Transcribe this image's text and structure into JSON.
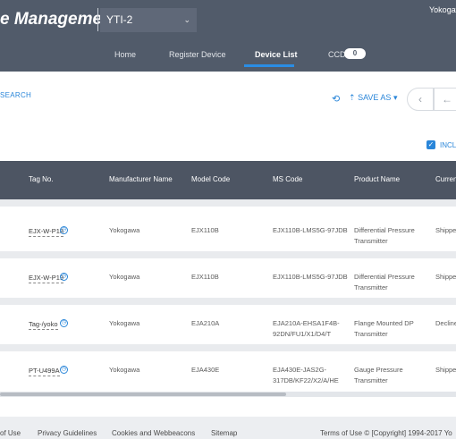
{
  "header": {
    "brand": "e Management",
    "tenant": "YTI-2",
    "user": "Yokogaw",
    "nav": [
      "Home",
      "Register Device",
      "Device List",
      "CCD"
    ],
    "ccd_count": "0"
  },
  "toolbar": {
    "search": "SEARCH",
    "save_as": "SAVE AS",
    "include_label": "INCLU"
  },
  "table": {
    "columns": [
      "Tag No.",
      "Manufacturer Name",
      "Model Code",
      "MS Code",
      "Product Name",
      "Curren"
    ],
    "rows": [
      {
        "tag": "EJX-W-P18",
        "manufacturer": "Yokogawa",
        "model": "EJX110B",
        "ms1": "EJX110B-LMS5G-97JDB",
        "ms2": "",
        "product1": "Differential Pressure",
        "product2": "Transmitter",
        "status": "Shippe"
      },
      {
        "tag": "EJX-W-P19",
        "manufacturer": "Yokogawa",
        "model": "EJX110B",
        "ms1": "EJX110B-LMS5G-97JDB",
        "ms2": "",
        "product1": "Differential Pressure",
        "product2": "Transmitter",
        "status": "Shippe"
      },
      {
        "tag": "Tag-/yoko",
        "manufacturer": "Yokogawa",
        "model": "EJA210A",
        "ms1": "EJA210A-EHSA1F4B-",
        "ms2": "92DN/FU1/X1/D4/T",
        "product1": "Flange Mounted DP",
        "product2": "Transmitter",
        "status": "Decline"
      },
      {
        "tag": "PT-U499A",
        "manufacturer": "Yokogawa",
        "model": "EJA430E",
        "ms1": "EJA430E-JAS2G-",
        "ms2": "317DB/KF22/X2/A/HE",
        "product1": "Gauge Pressure",
        "product2": "Transmitter",
        "status": "Shippe"
      }
    ]
  },
  "footer": {
    "links": [
      "of Use",
      "Privacy Guidelines",
      "Cookies and Webbeacons",
      "Sitemap"
    ],
    "copyright": "Terms of Use © [Copyright] 1994-2017 Yo"
  },
  "colors": {
    "header_bg": "#515b6a",
    "table_head_bg": "#4d5563",
    "accent": "#2a86d9"
  }
}
